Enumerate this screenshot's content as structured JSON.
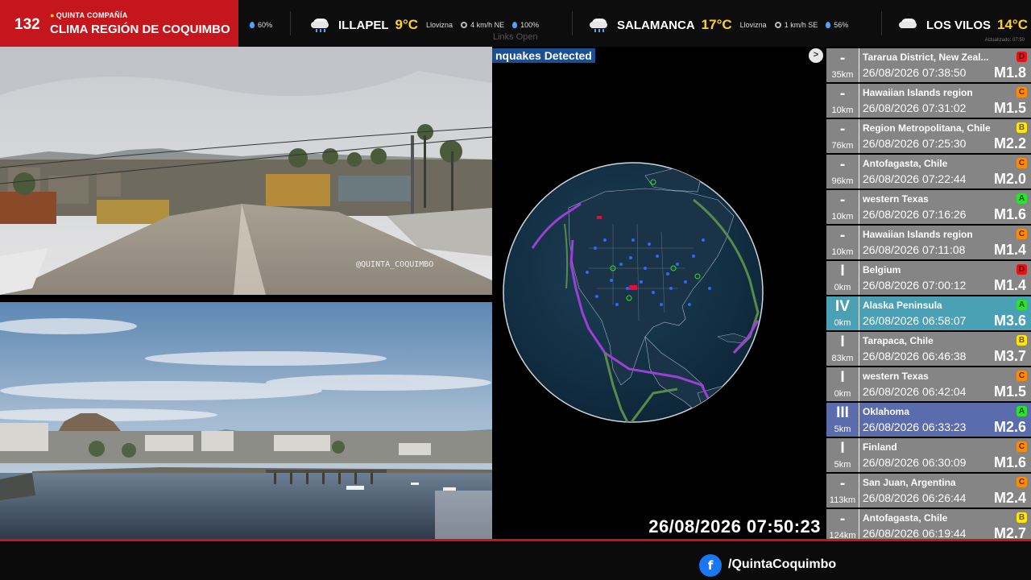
{
  "brand": {
    "number": "132",
    "company": "QUINTA COMPAÑÍA",
    "title": "CLIMA REGIÓN DE COQUIMBO"
  },
  "weather_ticker": {
    "lead_humidity": "60%",
    "items": [
      {
        "city": "ILLAPEL",
        "temp": "9°C",
        "condition": "Llovizna",
        "wind": "4 km/h NE",
        "humidity": "100%",
        "icon": "drizzle-cloud-icon"
      },
      {
        "city": "SALAMANCA",
        "temp": "17°C",
        "condition": "Llovizna",
        "wind": "1 km/h SE",
        "humidity": "56%",
        "icon": "drizzle-cloud-icon"
      },
      {
        "city": "LOS VILOS",
        "temp": "14°C",
        "icon": "cloud-icon"
      }
    ],
    "overlay_text": "Links  Open",
    "updated": "Actualizado: 07:50"
  },
  "cameras": [
    {
      "name": "city-rooftop-camera",
      "watermark": "@QUINTA_COQUIMBO"
    },
    {
      "name": "bay-camera"
    }
  ],
  "map": {
    "header": "nquakes Detected",
    "next_icon": "chevron-right-icon",
    "clock": "26/08/2026 07:50:23"
  },
  "quakes": [
    {
      "intensity": "-",
      "depth": "35km",
      "location": "Tararua District, New Zeal...",
      "time": "26/08/2026 07:38:50",
      "magnitude": "M1.8",
      "grade": "D",
      "highlight": ""
    },
    {
      "intensity": "-",
      "depth": "10km",
      "location": "Hawaiian Islands region",
      "time": "26/08/2026 07:31:02",
      "magnitude": "M1.5",
      "grade": "C",
      "highlight": ""
    },
    {
      "intensity": "-",
      "depth": "76km",
      "location": "Region Metropolitana, Chile",
      "time": "26/08/2026 07:25:30",
      "magnitude": "M2.2",
      "grade": "B",
      "highlight": ""
    },
    {
      "intensity": "-",
      "depth": "96km",
      "location": "Antofagasta, Chile",
      "time": "26/08/2026 07:22:44",
      "magnitude": "M2.0",
      "grade": "C",
      "highlight": ""
    },
    {
      "intensity": "-",
      "depth": "10km",
      "location": "western Texas",
      "time": "26/08/2026 07:16:26",
      "magnitude": "M1.6",
      "grade": "A",
      "highlight": ""
    },
    {
      "intensity": "-",
      "depth": "10km",
      "location": "Hawaiian Islands region",
      "time": "26/08/2026 07:11:08",
      "magnitude": "M1.4",
      "grade": "C",
      "highlight": ""
    },
    {
      "intensity": "I",
      "depth": "0km",
      "location": "Belgium",
      "time": "26/08/2026 07:00:12",
      "magnitude": "M1.4",
      "grade": "D",
      "highlight": ""
    },
    {
      "intensity": "IV",
      "depth": "0km",
      "location": "Alaska Peninsula",
      "time": "26/08/2026 06:58:07",
      "magnitude": "M3.6",
      "grade": "A",
      "highlight": "teal"
    },
    {
      "intensity": "I",
      "depth": "83km",
      "location": "Tarapaca, Chile",
      "time": "26/08/2026 06:46:38",
      "magnitude": "M3.7",
      "grade": "B",
      "highlight": ""
    },
    {
      "intensity": "I",
      "depth": "0km",
      "location": "western Texas",
      "time": "26/08/2026 06:42:04",
      "magnitude": "M1.5",
      "grade": "C",
      "highlight": ""
    },
    {
      "intensity": "III",
      "depth": "5km",
      "location": "Oklahoma",
      "time": "26/08/2026 06:33:23",
      "magnitude": "M2.6",
      "grade": "A",
      "highlight": "purple"
    },
    {
      "intensity": "I",
      "depth": "5km",
      "location": "Finland",
      "time": "26/08/2026 06:30:09",
      "magnitude": "M1.6",
      "grade": "C",
      "highlight": ""
    },
    {
      "intensity": "-",
      "depth": "113km",
      "location": "San Juan, Argentina",
      "time": "26/08/2026 06:26:44",
      "magnitude": "M2.4",
      "grade": "C",
      "highlight": ""
    },
    {
      "intensity": "-",
      "depth": "124km",
      "location": "Antofagasta, Chile",
      "time": "26/08/2026 06:19:44",
      "magnitude": "M2.7",
      "grade": "B",
      "highlight": ""
    }
  ],
  "footer": {
    "facebook_icon": "facebook-icon",
    "facebook_letter": "f",
    "handle": "/QuintaCoquimbo"
  },
  "colors": {
    "brand_red": "#c4161c",
    "temp_yellow": "#ffd21f",
    "map_header_blue": "#1c4f91",
    "plate_boundary_purple": "#9b3fd6",
    "plate_boundary_green": "#5a8a4a"
  }
}
